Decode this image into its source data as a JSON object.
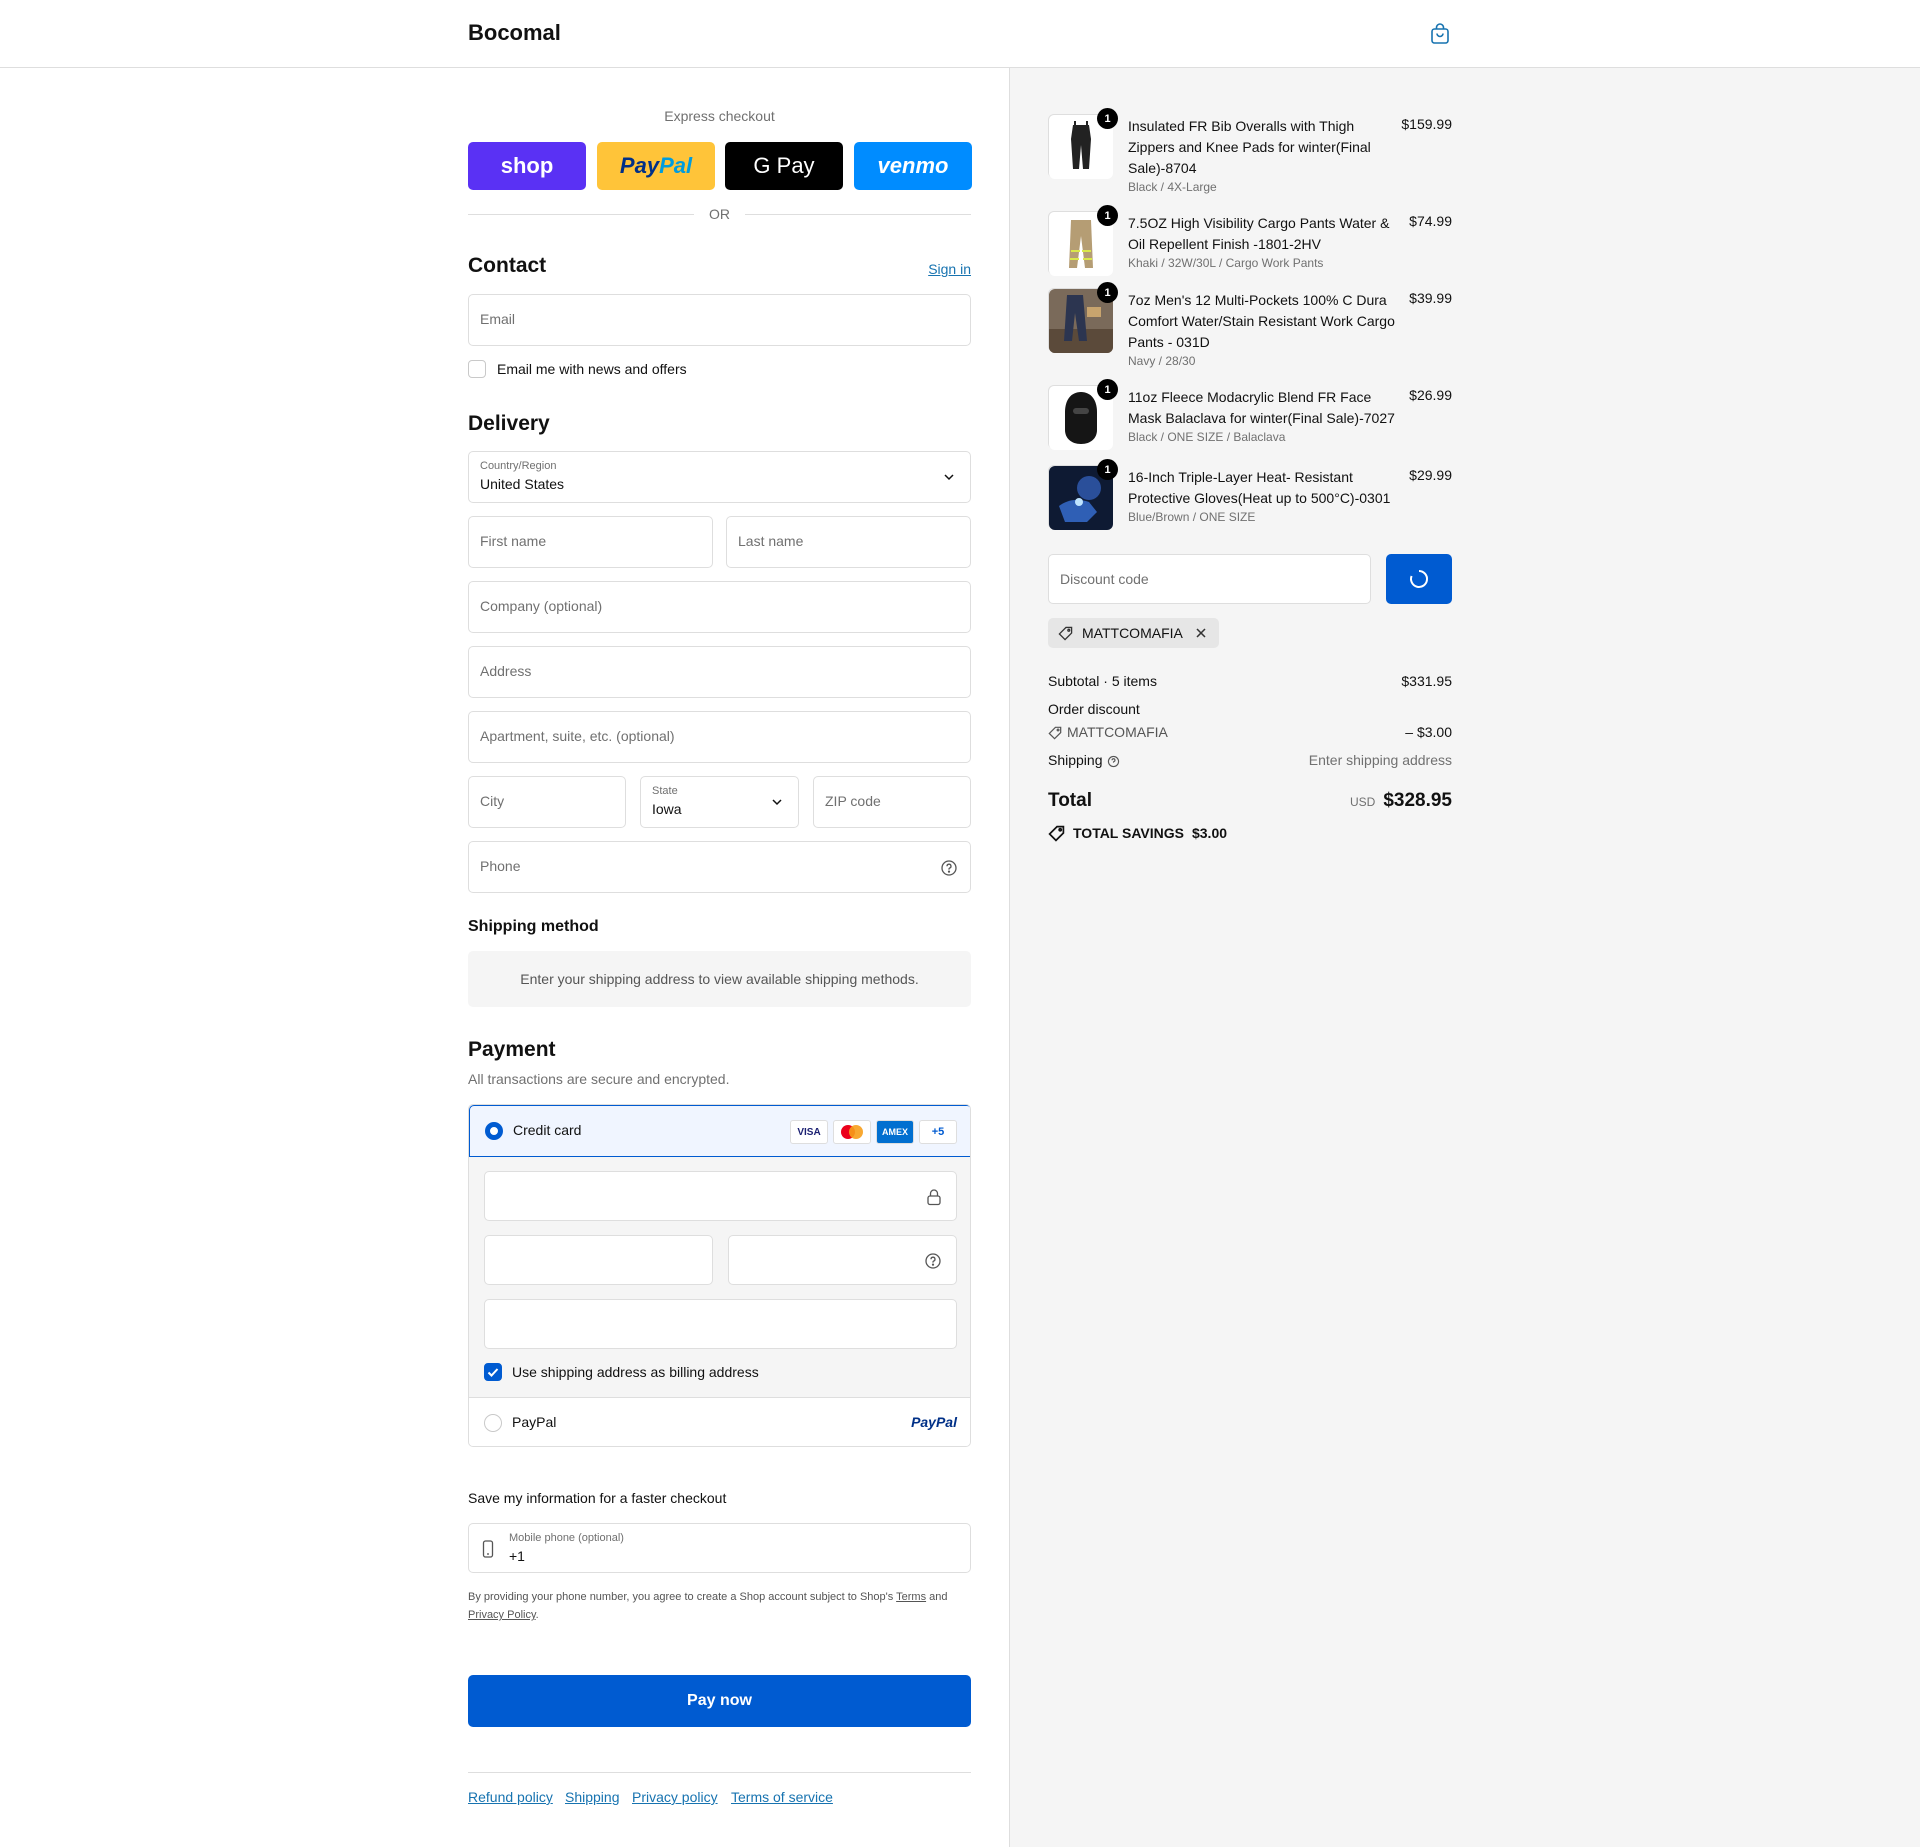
{
  "header": {
    "brand": "Bocomal"
  },
  "express": {
    "title": "Express checkout",
    "shop_label": "shop",
    "paypal_label": "PayPal",
    "gpay_label": "G Pay",
    "venmo_label": "venmo",
    "or_label": "OR"
  },
  "contact": {
    "title": "Contact",
    "sign_in": "Sign in",
    "email_placeholder": "Email",
    "news_label": "Email me with news and offers"
  },
  "delivery": {
    "title": "Delivery",
    "country_label": "Country/Region",
    "country_value": "United States",
    "first_name": "First name",
    "last_name": "Last name",
    "company": "Company (optional)",
    "address": "Address",
    "apartment": "Apartment, suite, etc. (optional)",
    "city": "City",
    "state_label": "State",
    "state_value": "Iowa",
    "zip": "ZIP code",
    "phone": "Phone"
  },
  "shipping_method": {
    "title": "Shipping method",
    "message": "Enter your shipping address to view available shipping methods."
  },
  "payment": {
    "title": "Payment",
    "subtitle": "All transactions are secure and encrypted.",
    "credit_card_label": "Credit card",
    "card_logos": [
      "VISA",
      "MC",
      "AMEX",
      "+5"
    ],
    "billing_label": "Use shipping address as billing address",
    "paypal_label": "PayPal",
    "paypal_logo": "PayPal"
  },
  "save_info": {
    "title": "Save my information for a faster checkout",
    "mobile_label": "Mobile phone (optional)",
    "mobile_value": "+1",
    "legal_prefix": "By providing your phone number, you agree to create a Shop account subject to Shop's",
    "terms": "Terms",
    "and": "and",
    "privacy": "Privacy Policy",
    "period": "."
  },
  "pay_now": "Pay now",
  "footer": {
    "links": [
      "Refund policy",
      "Shipping",
      "Privacy policy",
      "Terms of service"
    ]
  },
  "order": {
    "items": [
      {
        "qty": "1",
        "name": "Insulated FR Bib Overalls with Thigh Zippers and Knee Pads for winter(Final Sale)-8704",
        "variant": "Black / 4X-Large",
        "price": "$159.99"
      },
      {
        "qty": "1",
        "name": "7.5OZ High Visibility Cargo Pants Water & Oil Repellent Finish -1801-2HV",
        "variant": "Khaki / 32W/30L / Cargo Work Pants",
        "price": "$74.99"
      },
      {
        "qty": "1",
        "name": "7oz Men's 12 Multi-Pockets 100% C Dura Comfort Water/Stain Resistant Work Cargo Pants - 031D",
        "variant": "Navy / 28/30",
        "price": "$39.99"
      },
      {
        "qty": "1",
        "name": "11oz Fleece Modacrylic Blend FR Face Mask Balaclava for winter(Final Sale)-7027",
        "variant": "Black / ONE SIZE / Balaclava",
        "price": "$26.99"
      },
      {
        "qty": "1",
        "name": "16-Inch Triple-Layer Heat- Resistant Protective Gloves(Heat up to 500°C)-0301",
        "variant": "Blue/Brown / ONE SIZE",
        "price": "$29.99"
      }
    ],
    "discount_placeholder": "Discount code",
    "applied_code": "MATTCOMAFIA",
    "subtotal_label": "Subtotal · 5 items",
    "subtotal_value": "$331.95",
    "order_discount_label": "Order discount",
    "discount_code": "MATTCOMAFIA",
    "discount_value": "– $3.00",
    "shipping_label": "Shipping",
    "shipping_value": "Enter shipping address",
    "total_label": "Total",
    "currency": "USD",
    "total_value": "$328.95",
    "savings_label": "TOTAL SAVINGS",
    "savings_value": "$3.00"
  },
  "colors": {
    "accent": "#005bd1",
    "link": "#1773b0",
    "shop": "#5a31f4",
    "paypal": "#ffc439",
    "venmo": "#008cff"
  }
}
